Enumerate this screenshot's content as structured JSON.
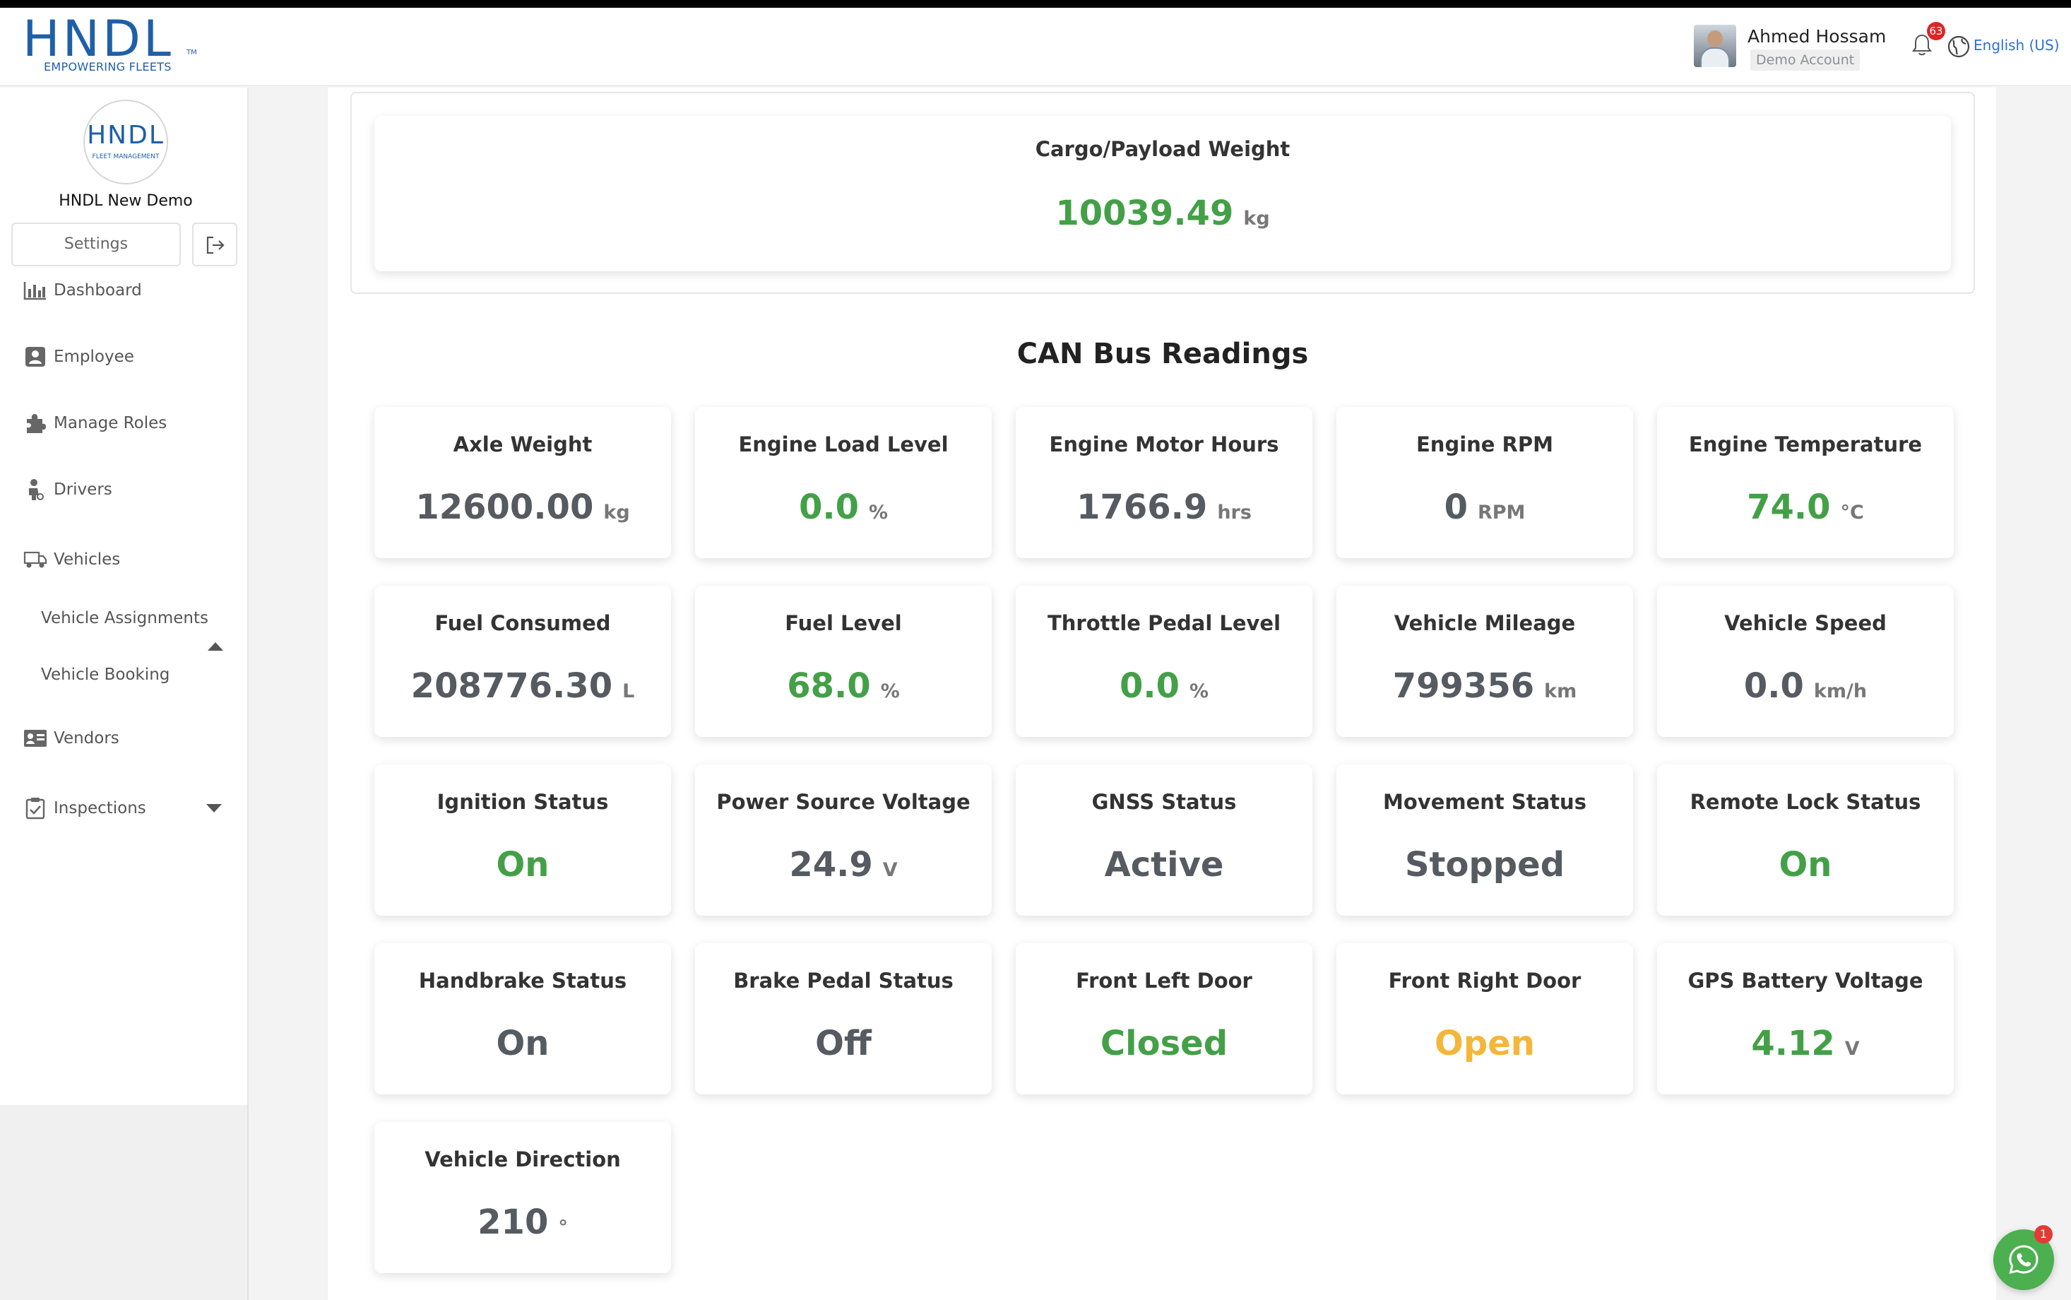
{
  "header": {
    "logo_word": "HNDL",
    "logo_tm": "TM",
    "logo_tagline": "EMPOWERING FLEETS",
    "user_name": "Ahmed Hossam",
    "user_role": "Demo Account",
    "notification_count": "63",
    "language": "English (US)"
  },
  "sidebar": {
    "org_logo_word": "HNDL",
    "org_logo_sub": "FLEET MANAGEMENT",
    "org_name": "HNDL New Demo",
    "settings_label": "Settings",
    "items": [
      {
        "label": "Dashboard",
        "icon": "bar-chart-icon"
      },
      {
        "label": "Employee",
        "icon": "id-badge-icon"
      },
      {
        "label": "Manage Roles",
        "icon": "puzzle-icon"
      },
      {
        "label": "Drivers",
        "icon": "driver-icon"
      },
      {
        "label": "Vehicles",
        "icon": "truck-icon",
        "expanded": true
      },
      {
        "label": "Vehicle Assignments",
        "sub": true
      },
      {
        "label": "Vehicle Booking",
        "sub": true
      },
      {
        "label": "Vendors",
        "icon": "vendor-card-icon"
      },
      {
        "label": "Inspections",
        "icon": "clipboard-check-icon",
        "expanded": false
      }
    ]
  },
  "payload": {
    "title": "Cargo/Payload Weight",
    "value": "10039.49",
    "unit": "kg"
  },
  "can_bus": {
    "title": "CAN Bus Readings",
    "readings": [
      {
        "title": "Axle Weight",
        "value": "12600.00",
        "unit": "kg",
        "color": "gray"
      },
      {
        "title": "Engine Load Level",
        "value": "0.0",
        "unit": "%",
        "color": "green"
      },
      {
        "title": "Engine Motor Hours",
        "value": "1766.9",
        "unit": "hrs",
        "color": "gray"
      },
      {
        "title": "Engine RPM",
        "value": "0",
        "unit": "RPM",
        "color": "gray"
      },
      {
        "title": "Engine Temperature",
        "value": "74.0",
        "unit": "°C",
        "color": "green"
      },
      {
        "title": "Fuel Consumed",
        "value": "208776.30",
        "unit": "L",
        "color": "gray"
      },
      {
        "title": "Fuel Level",
        "value": "68.0",
        "unit": "%",
        "color": "green"
      },
      {
        "title": "Throttle Pedal Level",
        "value": "0.0",
        "unit": "%",
        "color": "green"
      },
      {
        "title": "Vehicle Mileage",
        "value": "799356",
        "unit": "km",
        "color": "gray"
      },
      {
        "title": "Vehicle Speed",
        "value": "0.0",
        "unit": "km/h",
        "color": "gray"
      },
      {
        "title": "Ignition Status",
        "value": "On",
        "unit": "",
        "color": "green"
      },
      {
        "title": "Power Source Voltage",
        "value": "24.9",
        "unit": "V",
        "color": "gray"
      },
      {
        "title": "GNSS Status",
        "value": "Active",
        "unit": "",
        "color": "gray"
      },
      {
        "title": "Movement Status",
        "value": "Stopped",
        "unit": "",
        "color": "gray"
      },
      {
        "title": "Remote Lock Status",
        "value": "On",
        "unit": "",
        "color": "green"
      },
      {
        "title": "Handbrake Status",
        "value": "On",
        "unit": "",
        "color": "gray"
      },
      {
        "title": "Brake Pedal Status",
        "value": "Off",
        "unit": "",
        "color": "gray"
      },
      {
        "title": "Front Left Door",
        "value": "Closed",
        "unit": "",
        "color": "green"
      },
      {
        "title": "Front Right Door",
        "value": "Open",
        "unit": "",
        "color": "yellow"
      },
      {
        "title": "GPS Battery Voltage",
        "value": "4.12",
        "unit": "V",
        "color": "green"
      },
      {
        "title": "Vehicle Direction",
        "value": "210",
        "unit": "°",
        "color": "gray"
      }
    ]
  },
  "chat": {
    "icon": "whatsapp-icon",
    "badge": "1"
  },
  "colors": {
    "brand": "#1f5fa8",
    "green": "#43a047",
    "yellow": "#f4b63a",
    "gray": "#555b61",
    "badge": "#e02424"
  }
}
